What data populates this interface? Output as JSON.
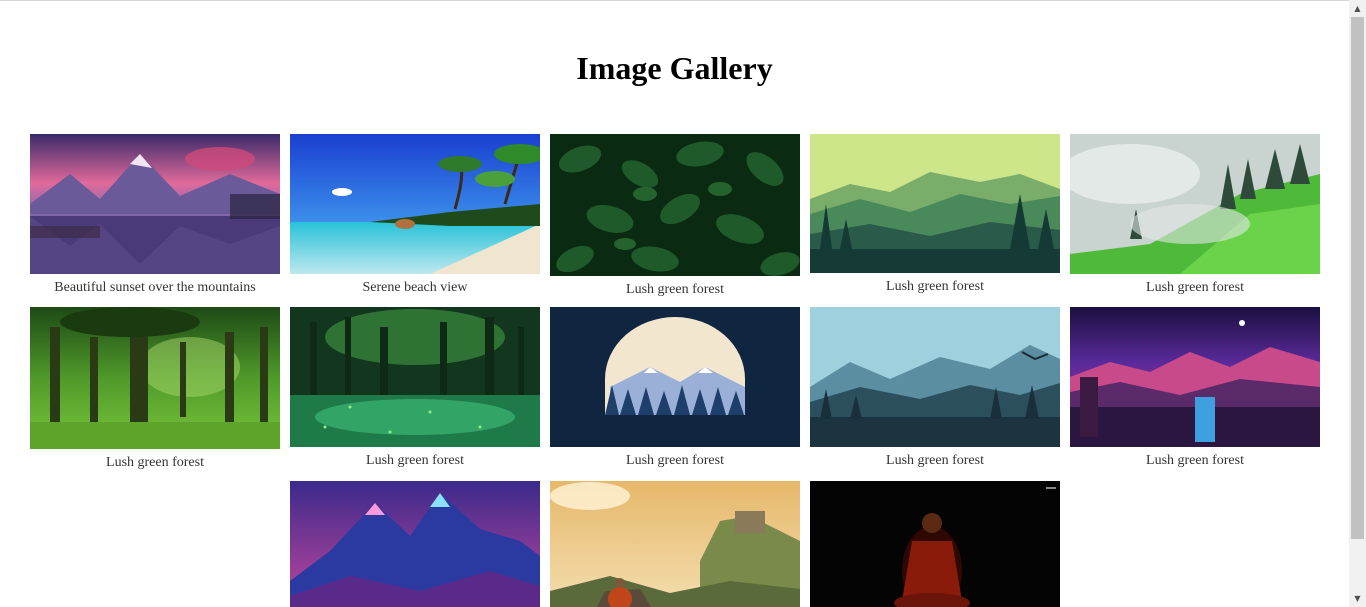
{
  "page": {
    "title": "Image Gallery"
  },
  "gallery": {
    "items": [
      {
        "caption": "Beautiful sunset over the mountains",
        "image": "sunset-mountain-lake"
      },
      {
        "caption": "Serene beach view",
        "image": "tropical-beach"
      },
      {
        "caption": "Lush green forest",
        "image": "green-leaves"
      },
      {
        "caption": "Lush green forest",
        "image": "flat-forest-mountains"
      },
      {
        "caption": "Lush green forest",
        "image": "misty-green-hills"
      },
      {
        "caption": "Lush green forest",
        "image": "sunlit-forest"
      },
      {
        "caption": "Lush green forest",
        "image": "enchanted-forest-water"
      },
      {
        "caption": "Lush green forest",
        "image": "moon-mountain-circle"
      },
      {
        "caption": "Lush green forest",
        "image": "blue-mountain-forest"
      },
      {
        "caption": "Lush green forest",
        "image": "purple-night-mountains"
      },
      {
        "caption": "",
        "image": "neon-mountains"
      },
      {
        "caption": "",
        "image": "monk-cliff-castle"
      },
      {
        "caption": "",
        "image": "monk-meditating-dark"
      }
    ]
  },
  "scrollbar": {
    "up_icon": "arrow-up-icon",
    "down_icon": "arrow-down-icon"
  }
}
